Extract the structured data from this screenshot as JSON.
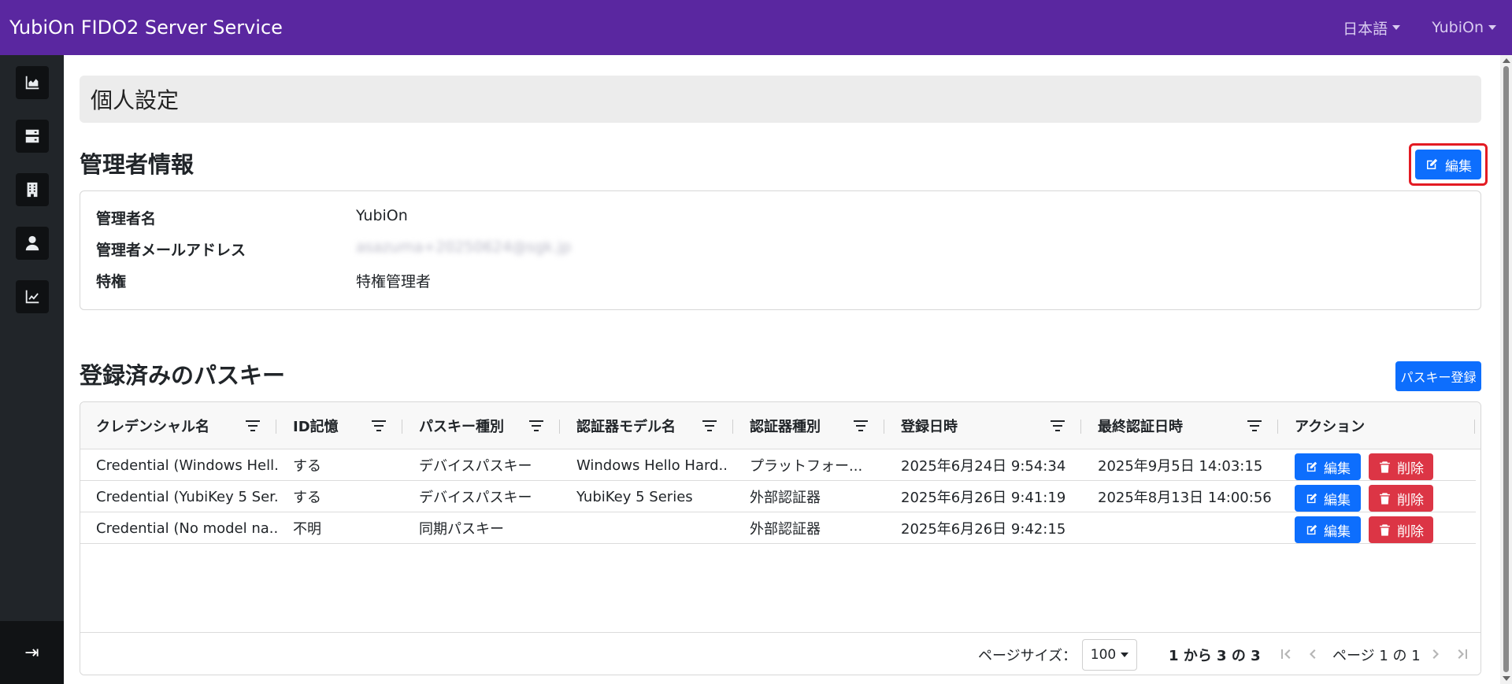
{
  "app": {
    "brand": "YubiOn FIDO2 Server Service",
    "language_menu": "日本語",
    "user_menu": "YubiOn"
  },
  "sidebar": {
    "items": [
      {
        "icon": "chart-area-icon"
      },
      {
        "icon": "server-icon"
      },
      {
        "icon": "building-icon"
      },
      {
        "icon": "user-icon"
      },
      {
        "icon": "chart-line-icon"
      }
    ],
    "collapse_glyph": "⇥"
  },
  "page": {
    "title": "個人設定"
  },
  "admin_info": {
    "title": "管理者情報",
    "edit_label": "編集",
    "rows": [
      {
        "label": "管理者名",
        "value": "YubiOn"
      },
      {
        "label": "管理者メールアドレス",
        "value": "asazuma+20250624@sgk.jp"
      },
      {
        "label": "特権",
        "value": "特権管理者"
      }
    ]
  },
  "passkeys": {
    "title": "登録済みのパスキー",
    "register_label": "パスキー登録",
    "columns": [
      "クレデンシャル名",
      "ID記憶",
      "パスキー種別",
      "認証器モデル名",
      "認証器種別",
      "登録日時",
      "最終認証日時",
      "アクション"
    ],
    "rows": [
      [
        "Credential (Windows Hell...",
        "する",
        "デバイスパスキー",
        "Windows Hello Hard...",
        "プラットフォー...",
        "2025年6月24日 9:54:34",
        "2025年9月5日 14:03:15"
      ],
      [
        "Credential (YubiKey 5 Ser...",
        "する",
        "デバイスパスキー",
        "YubiKey 5 Series",
        "外部認証器",
        "2025年6月26日 9:41:19",
        "2025年8月13日 14:00:56"
      ],
      [
        "Credential (No model na...",
        "不明",
        "同期パスキー",
        "",
        "外部認証器",
        "2025年6月26日 9:42:15",
        ""
      ]
    ],
    "edit_label": "編集",
    "delete_label": "削除",
    "footer": {
      "page_size_label": "ページサイズ：",
      "page_size_value": "100",
      "range_text": "1 から 3 の 3",
      "page_text": "ページ 1 の 1"
    }
  }
}
